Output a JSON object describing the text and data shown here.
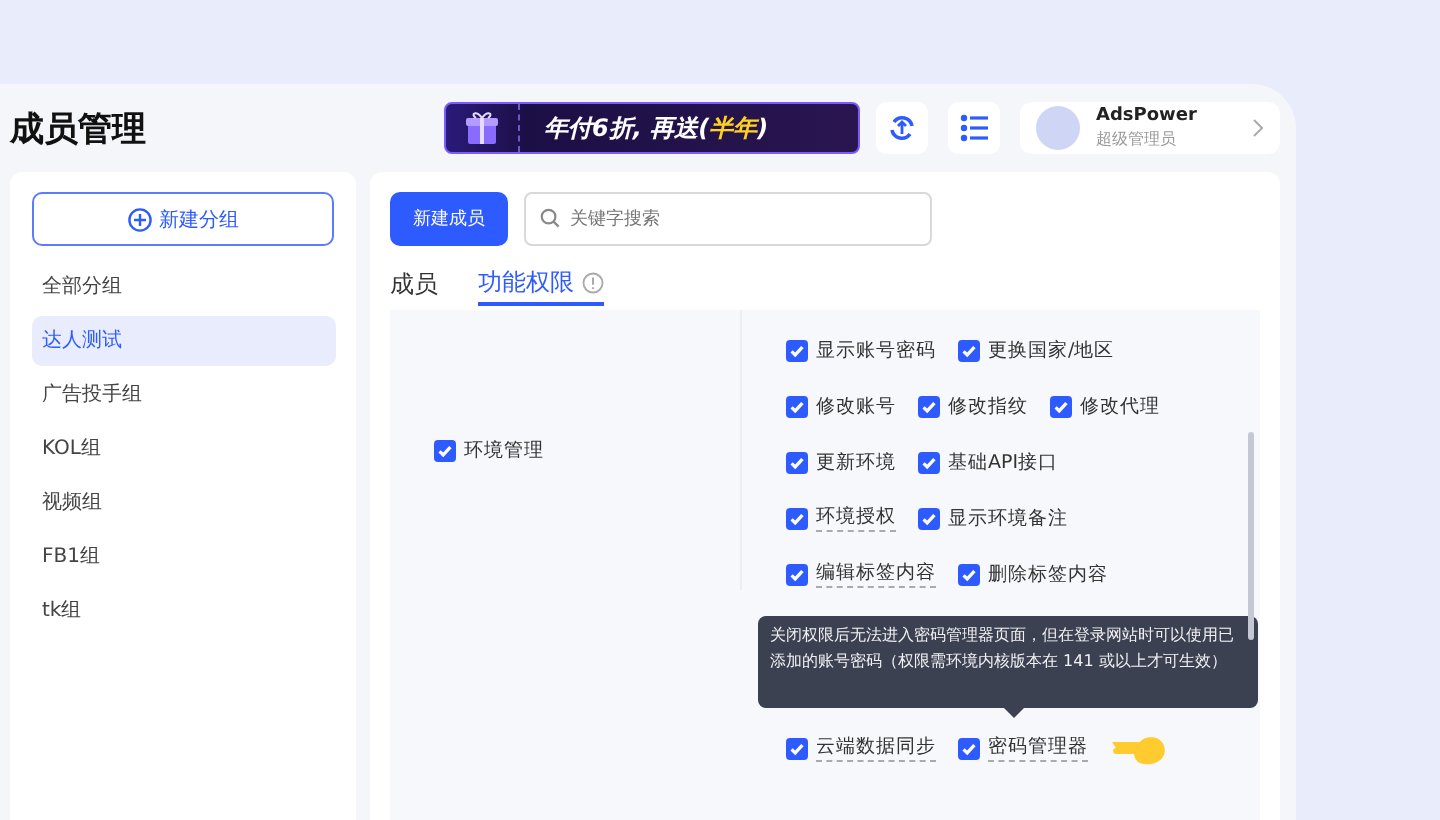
{
  "page_title": "成员管理",
  "promo": {
    "text": "年付6折, 再送(**半年**)"
  },
  "profile": {
    "name": "AdsPower",
    "role": "超级管理员"
  },
  "sidebar": {
    "new_group_button": "新建分组",
    "items": [
      {
        "label": "全部分组",
        "selected": false
      },
      {
        "label": "达人测试",
        "selected": true
      },
      {
        "label": "广告投手组",
        "selected": false
      },
      {
        "label": "KOL组",
        "selected": false
      },
      {
        "label": "视频组",
        "selected": false
      },
      {
        "label": "FB1组",
        "selected": false
      },
      {
        "label": "tk组",
        "selected": false
      }
    ]
  },
  "toolbar": {
    "new_member_button": "新建成员",
    "search": {
      "placeholder": "关键字搜索"
    }
  },
  "tabs": [
    {
      "label": "成员",
      "selected": false
    },
    {
      "label": "功能权限",
      "selected": true
    }
  ],
  "permissions": {
    "group": {
      "label": "环境管理",
      "checked": true
    },
    "rows": [
      [
        {
          "label": "显示账号密码",
          "checked": true,
          "has_tip": false
        },
        {
          "label": "更换国家/地区",
          "checked": true,
          "has_tip": false
        }
      ],
      [
        {
          "label": "修改账号",
          "checked": true,
          "has_tip": false
        },
        {
          "label": "修改指纹",
          "checked": true,
          "has_tip": false
        },
        {
          "label": "修改代理",
          "checked": true,
          "has_tip": false
        }
      ],
      [
        {
          "label": "更新环境",
          "checked": true,
          "has_tip": false
        },
        {
          "label": "基础API接口",
          "checked": true,
          "has_tip": false
        }
      ],
      [
        {
          "label": "环境授权",
          "checked": true,
          "has_tip": true
        },
        {
          "label": "显示环境备注",
          "checked": true,
          "has_tip": false
        }
      ],
      [
        {
          "label": "编辑标签内容",
          "checked": true,
          "has_tip": true
        },
        {
          "label": "删除标签内容",
          "checked": true,
          "has_tip": false
        }
      ],
      {
        "tooltip": "关闭权限后无法进入密码管理器页面，但在登录网站时可以使用已添加的账号密码（权限需环境内核版本在 141 或以上才可生效）"
      },
      [
        {
          "label": "云端数据同步",
          "checked": true,
          "has_tip": true
        },
        {
          "label": "密码管理器",
          "checked": true,
          "has_tip": true,
          "pointer": true
        }
      ]
    ]
  }
}
